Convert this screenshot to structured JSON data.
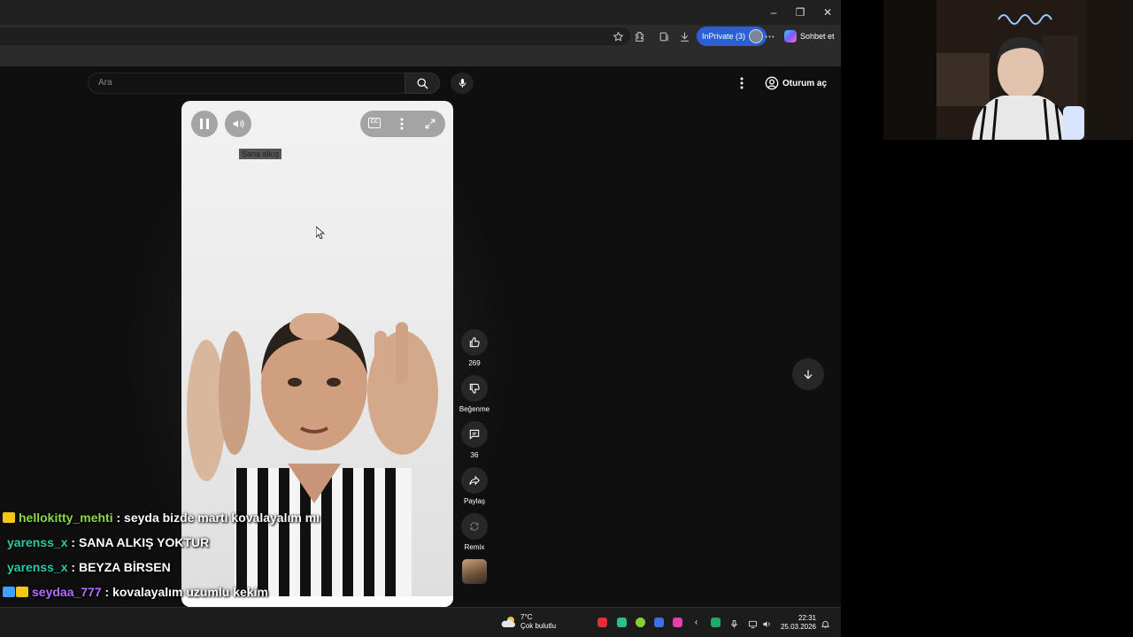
{
  "browser": {
    "inprivate_label": "InPrivate (3)",
    "copilot_label": "Sohbet et"
  },
  "youtube": {
    "search_placeholder": "Ara",
    "signin_label": "Oturum aç",
    "short": {
      "caption_text": "Sana alkış",
      "likes": "269",
      "dislike_label": "Beğenme",
      "comments": "36",
      "share_label": "Paylaş",
      "remix_label": "Remix"
    }
  },
  "chat": [
    {
      "user": "hellokitty_mehti",
      "message": ": seyda bizde martı kovalayalım mı",
      "color": "#8bd84a",
      "badge": "#f5c518"
    },
    {
      "user": "yarenss_x",
      "message": ": SANA ALKIŞ YOKTUR",
      "color": "#2ec9a6",
      "badge": ""
    },
    {
      "user": "yarenss_x",
      "message": ": BEYZA BİRSEN",
      "color": "#2ec9a6",
      "badge": ""
    },
    {
      "user": "seydaa_777",
      "message": ": kovalayalım uzumlu kekim",
      "color": "#b36dff",
      "badge": "#3fa0ff"
    }
  ],
  "taskbar": {
    "weather_temp": "7°C",
    "weather_desc": "Çok bulutlu",
    "time": "22:31",
    "date": "25.03.2026"
  }
}
